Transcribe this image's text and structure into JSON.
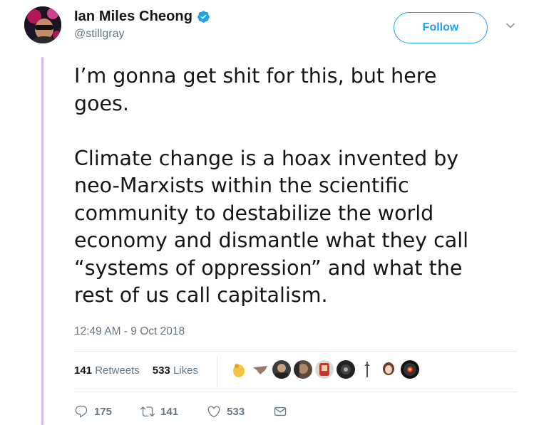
{
  "author": {
    "display_name": "Ian Miles Cheong",
    "handle": "@stillgray",
    "verified_icon": "verified-badge-icon",
    "accent_color": "#1da1f2"
  },
  "follow_button": {
    "label": "Follow"
  },
  "tweet": {
    "text": "I’m gonna get shit for this, but here\ngoes.\n\nClimate change is a hoax invented by\nneo-Marxists within the scientific\ncommunity to destabilize the world\neconomy and dismantle what they call\n“systems of oppression” and what the\nrest of us call capitalism.",
    "timestamp": "12:49 AM - 9 Oct 2018"
  },
  "stats": {
    "retweets_count": "141",
    "retweets_label": "Retweets",
    "likes_count": "533",
    "likes_label": "Likes"
  },
  "actions": {
    "replies": "175",
    "retweets": "141",
    "likes": "533"
  },
  "colors": {
    "thread_line": "#d7b8ec",
    "secondary_text": "#657786",
    "primary_text": "#14171a"
  }
}
